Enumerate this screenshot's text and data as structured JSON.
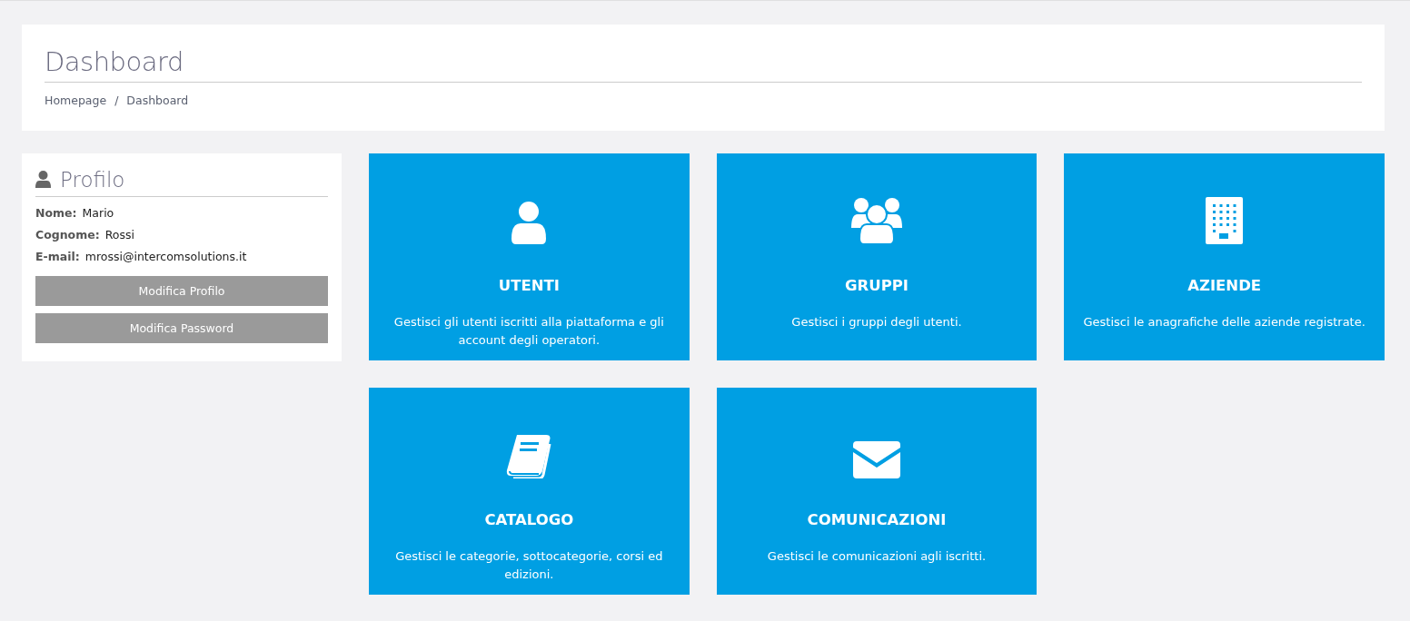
{
  "header": {
    "title": "Dashboard",
    "breadcrumb": [
      "Homepage",
      "Dashboard"
    ],
    "separator": "/"
  },
  "profile": {
    "title": "Profilo",
    "fields": [
      {
        "label": "Nome:",
        "value": "Mario"
      },
      {
        "label": "Cognome:",
        "value": "Rossi"
      },
      {
        "label": "E-mail:",
        "value": "mrossi@intercomsolutions.it"
      }
    ],
    "buttons": [
      "Modifica Profilo",
      "Modifica Password"
    ]
  },
  "tiles": [
    {
      "title": "UTENTI",
      "description": "Gestisci gli utenti iscritti alla piattaforma e gli account degli operatori."
    },
    {
      "title": "GRUPPI",
      "description": "Gestisci i gruppi degli utenti."
    },
    {
      "title": "AZIENDE",
      "description": "Gestisci le anagrafiche delle aziende registrate."
    },
    {
      "title": "CATALOGO",
      "description": "Gestisci le categorie, sottocategorie, corsi ed edizioni."
    },
    {
      "title": "COMUNICAZIONI",
      "description": "Gestisci le comunicazioni agli iscritti."
    }
  ]
}
